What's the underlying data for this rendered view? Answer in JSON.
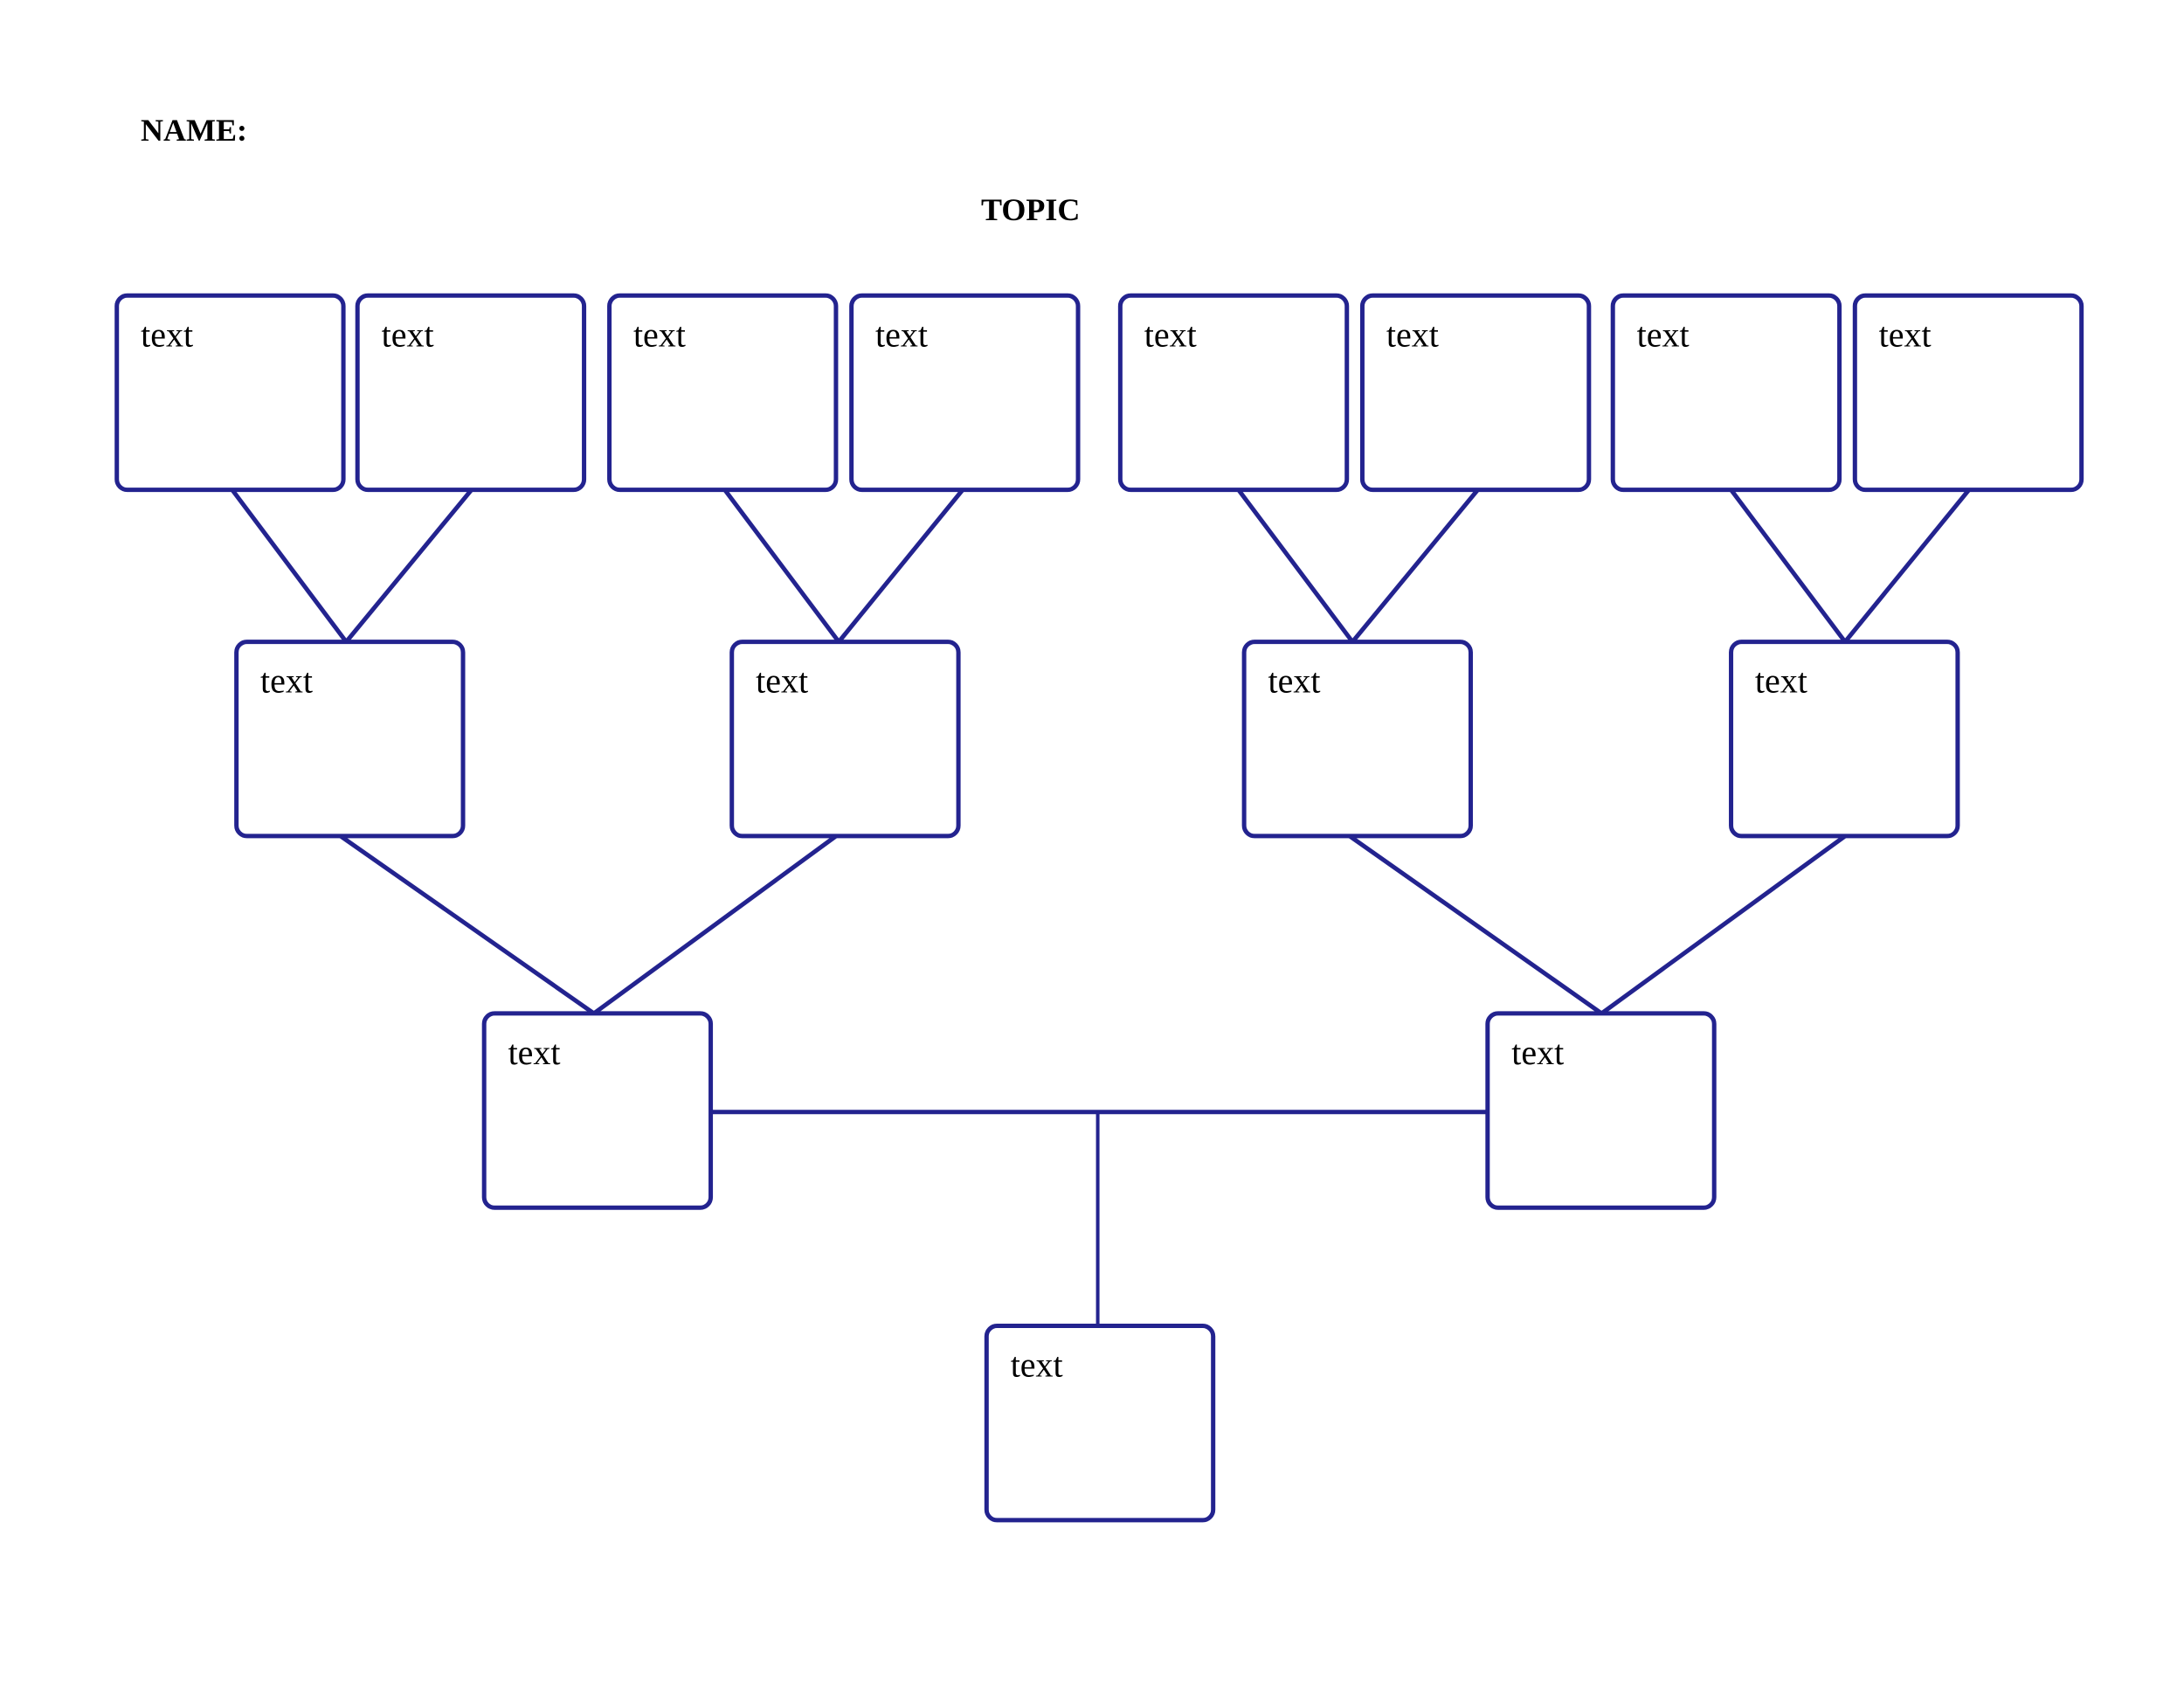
{
  "header": {
    "name_label": "NAME:",
    "topic_label": "TOPIC"
  },
  "colors": {
    "stroke": "#23238f",
    "text": "#000000"
  },
  "tree": {
    "root": {
      "label": "text"
    },
    "level1": [
      {
        "label": "text"
      },
      {
        "label": "text"
      }
    ],
    "level2": [
      {
        "label": "text"
      },
      {
        "label": "text"
      },
      {
        "label": "text"
      },
      {
        "label": "text"
      }
    ],
    "level3": [
      {
        "label": "text"
      },
      {
        "label": "text"
      },
      {
        "label": "text"
      },
      {
        "label": "text"
      },
      {
        "label": "text"
      },
      {
        "label": "text"
      },
      {
        "label": "text"
      },
      {
        "label": "text"
      }
    ]
  }
}
